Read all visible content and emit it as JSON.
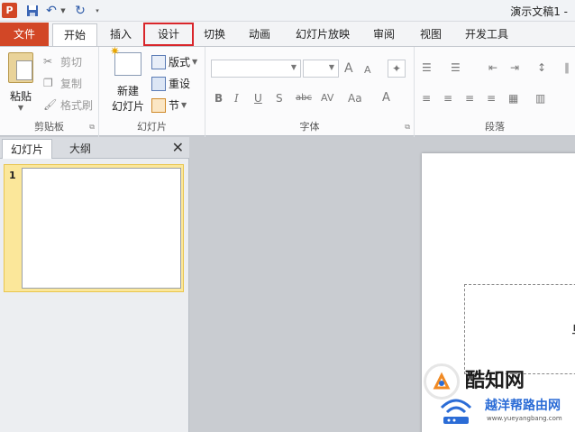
{
  "titlebar": {
    "app_letter": "P",
    "document_title": "演示文稿1 -"
  },
  "tabs": [
    {
      "label": "文件"
    },
    {
      "label": "开始"
    },
    {
      "label": "插入"
    },
    {
      "label": "设计"
    },
    {
      "label": "切换"
    },
    {
      "label": "动画"
    },
    {
      "label": "幻灯片放映"
    },
    {
      "label": "审阅"
    },
    {
      "label": "视图"
    },
    {
      "label": "开发工具"
    }
  ],
  "ribbon": {
    "clipboard": {
      "paste": "粘贴",
      "cut": "剪切",
      "copy": "复制",
      "format_painter": "格式刷",
      "group_label": "剪贴板"
    },
    "slides": {
      "new_slide_line1": "新建",
      "new_slide_line2": "幻灯片",
      "layout": "版式",
      "reset": "重设",
      "section": "节",
      "group_label": "幻灯片"
    },
    "font": {
      "group_label": "字体",
      "grow": "A",
      "shrink": "A",
      "bold": "B",
      "italic": "I",
      "underline": "U",
      "shadow": "S",
      "strike": "abc",
      "spacing": "AV",
      "case": "Aa",
      "color": "A"
    },
    "paragraph": {
      "group_label": "段落"
    }
  },
  "panel": {
    "tab_slides": "幻灯片",
    "tab_outline": "大纲",
    "close": "✕",
    "slide_number": "1"
  },
  "watermark": {
    "brand": "酷知网",
    "brand_cn": "越洋帮路由网",
    "brand_url": "www.yueyangbang.com"
  },
  "colors": {
    "file_tab": "#d24726",
    "highlight_box": "#d9262b",
    "selected_thumb": "#fbe79a"
  }
}
